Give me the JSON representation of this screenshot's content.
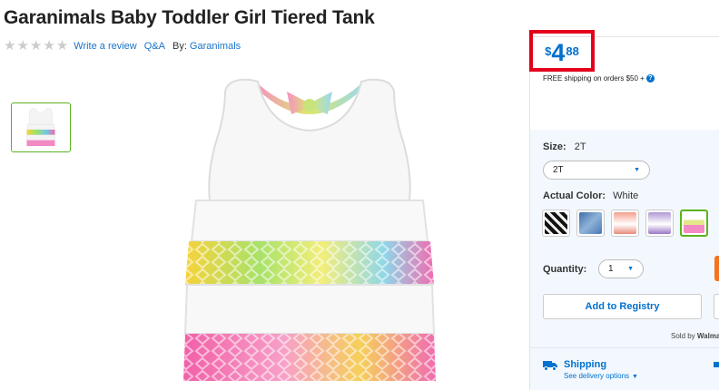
{
  "product": {
    "title": "Garanimals Baby Toddler Girl Tiered Tank"
  },
  "reviews": {
    "rating": 0,
    "write_review_label": "Write a review",
    "qa_label": "Q&A",
    "by_label": "By:",
    "brand": "Garanimals"
  },
  "price": {
    "currency": "$",
    "whole": "4",
    "cents": "88",
    "shipping_note": "FREE shipping on orders $50 +",
    "highlight_color": "#e3001b"
  },
  "size": {
    "label": "Size:",
    "value": "2T",
    "selected": "2T"
  },
  "color": {
    "label": "Actual Color:",
    "value": "White",
    "swatches": [
      {
        "name": "black-white-pattern",
        "color": "#222222"
      },
      {
        "name": "blue-pattern",
        "color": "#4a78b4"
      },
      {
        "name": "coral-pattern",
        "color": "#e88a7a"
      },
      {
        "name": "purple-pattern",
        "color": "#9a78c4"
      },
      {
        "name": "white-rainbow",
        "color": "#e4e78a",
        "selected": true
      }
    ]
  },
  "quantity": {
    "label": "Quantity:",
    "value": "1"
  },
  "registry": {
    "button_label": "Add to Registry"
  },
  "seller": {
    "prefix": "Sold by",
    "name": "Walma"
  },
  "shipping": {
    "title": "Shipping",
    "link": "See delivery options",
    "icon": "truck-icon"
  },
  "theme": {
    "accent": "#0071ce",
    "selected_border": "#5bb31d",
    "panel_bg": "#f2f8fd"
  }
}
